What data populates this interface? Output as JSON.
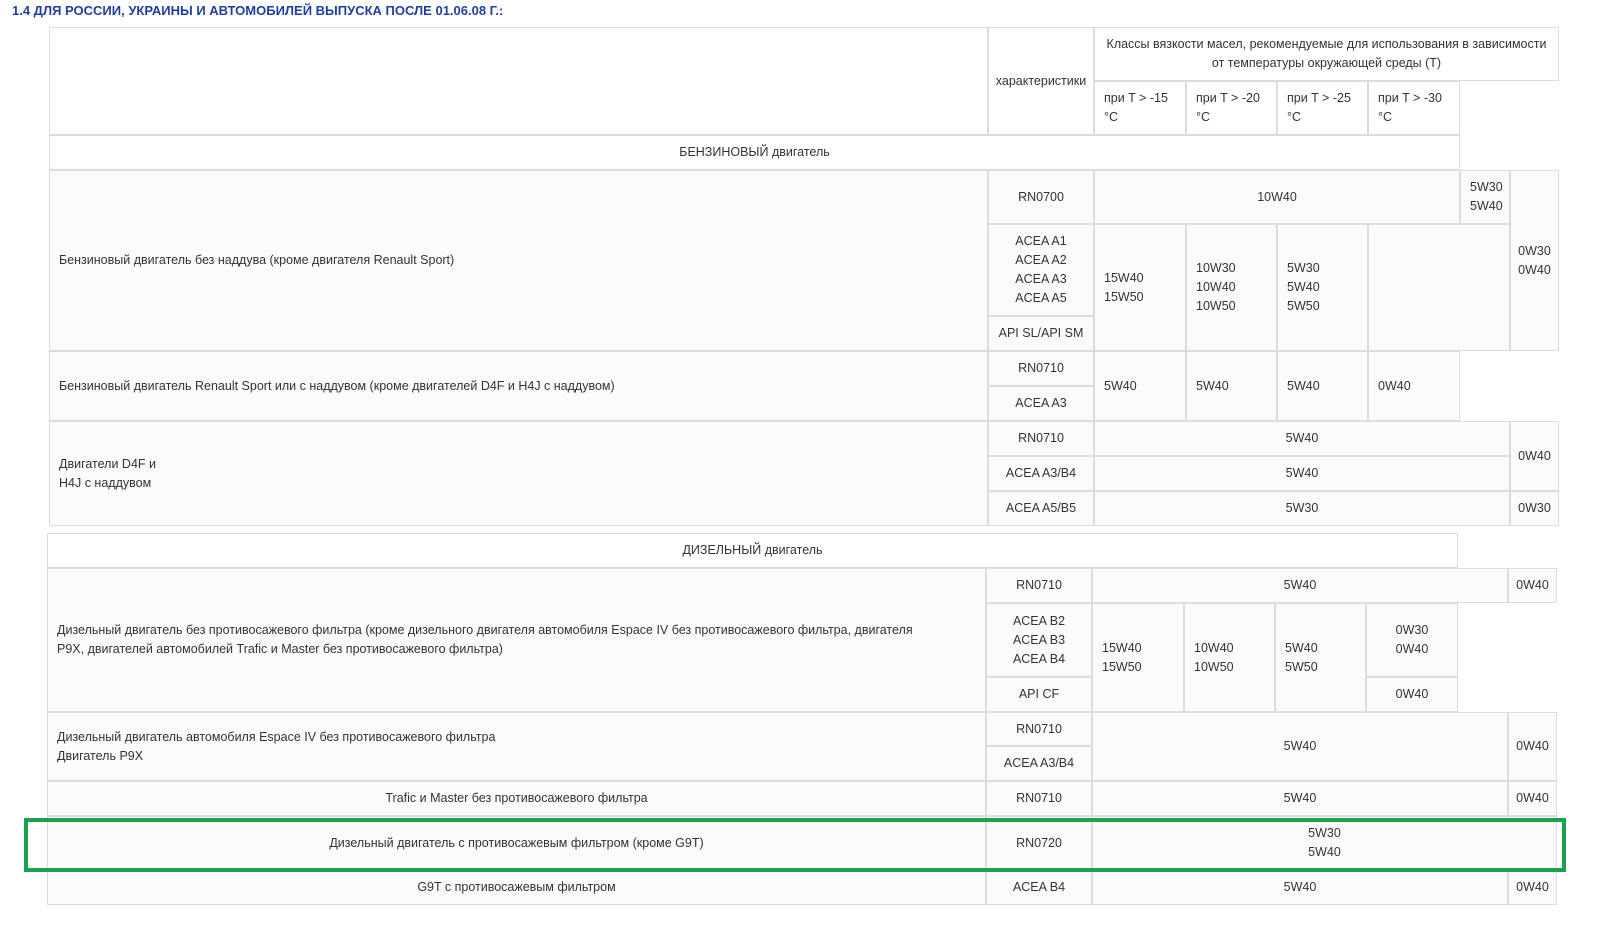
{
  "page": {
    "heading": "1.4 ДЛЯ РОССИИ, УКРАИНЫ И АВТОМОБИЛЕЙ ВЫПУСКА ПОСЛЕ 01.06.08 Г.:"
  },
  "header": {
    "characteristics": "характеристики",
    "viscosity_title": "Классы вязкости масел, рекомендуемые для использования в зависимости от температуры окружающей среды (T)",
    "temp_cols": [
      "при T > -15\n°C",
      "при T > -20\n°C",
      "при T > -25\n°C",
      "при T > -30\n°C"
    ]
  },
  "sections": {
    "petrol": "БЕНЗИНОВЫЙ двигатель",
    "diesel": "ДИЗЕЛЬНЫЙ двигатель"
  },
  "rows": {
    "petrol_na": {
      "name": "Бензиновый двигатель без наддува (кроме двигателя Renault Sport)",
      "spec1": "RN0700",
      "spec1_oil": "10W40",
      "spec1_extra": "5W30\n5W40",
      "spec2": "ACEA A1\nACEA A2\nACEA A3\nACEA A5",
      "spec3": "API SL/API SM",
      "t15": "15W40\n15W50",
      "t20": "10W30\n10W40\n10W50",
      "t25": "5W30\n5W40\n5W50",
      "t30": "0W30\n0W40"
    },
    "petrol_sport": {
      "name": "Бензиновый двигатель Renault Sport или с наддувом (кроме двигателей D4F и H4J с наддувом)",
      "spec1": "RN0710",
      "spec2": "ACEA A3",
      "t15": "5W40",
      "t20": "5W40",
      "t25": "5W40",
      "t30": "0W40"
    },
    "d4f": {
      "name": "Двигатели D4F и\nH4J с наддувом",
      "spec1": "RN0710",
      "spec1_oil": "5W40",
      "spec2": "ACEA A3/B4",
      "spec2_oil": "5W40",
      "extra12": "0W40",
      "spec3": "ACEA A5/B5",
      "spec3_oil": "5W30",
      "extra3": "0W30"
    },
    "diesel_nofilter": {
      "name": "Дизельный двигатель без противосажевого фильтра (кроме дизельного двигателя автомобиля Espace IV без противосажевого фильтра, двигателя P9X, двигателей автомобилей Trafic и Master без противосажевого фильтра)",
      "spec1": "RN0710",
      "spec1_oil": "5W40",
      "spec1_extra": "0W40",
      "spec2": "ACEA B2\nACEA B3\nACEA B4",
      "spec3": "API CF",
      "t15": "15W40\n15W50",
      "t20": "10W40\n10W50",
      "t25": "5W40\n5W50",
      "t30a": "0W30\n0W40",
      "t30b": "0W40"
    },
    "espace": {
      "name": "Дизельный двигатель автомобиля Espace IV без противосажевого фильтра\nДвигатель P9X",
      "spec1": "RN0710",
      "spec2": "ACEA A3/B4",
      "oil": "5W40",
      "extra": "0W40"
    },
    "trafic": {
      "name": "Trafic и Master без противосажевого фильтра",
      "spec": "RN0710",
      "oil": "5W40",
      "extra": "0W40"
    },
    "dpf": {
      "name": "Дизельный двигатель с противосажевым фильтром (кроме G9T)",
      "spec": "RN0720",
      "oil": "5W30\n5W40"
    },
    "g9t": {
      "name": "G9T с противосажевым фильтром",
      "spec": "ACEA B4",
      "oil": "5W40",
      "extra": "0W40"
    }
  },
  "colors": {
    "heading": "#1f3f9f",
    "highlight_border": "#1aa34a",
    "cell_border": "#dcdcdc"
  }
}
